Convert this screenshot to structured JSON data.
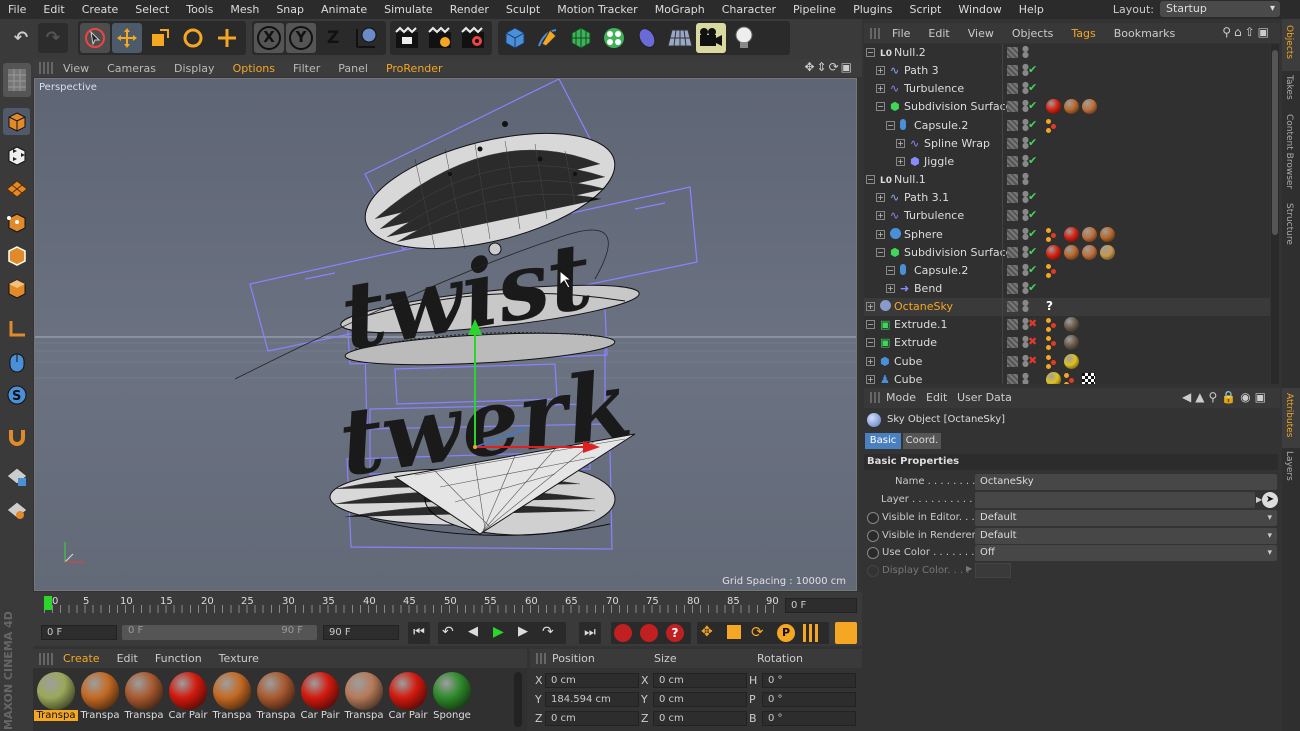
{
  "menubar": {
    "items": [
      "File",
      "Edit",
      "Create",
      "Select",
      "Tools",
      "Mesh",
      "Snap",
      "Animate",
      "Simulate",
      "Render",
      "Sculpt",
      "Motion Tracker",
      "MoGraph",
      "Character",
      "Pipeline",
      "Plugins",
      "Script",
      "Window",
      "Help"
    ],
    "layout_label": "Layout:",
    "layout_value": "Startup"
  },
  "toolbar": {
    "axis_x": "X",
    "axis_y": "Y",
    "axis_z": "Z"
  },
  "viewport_menu": [
    "View",
    "Cameras",
    "Display",
    "Options",
    "Filter",
    "Panel",
    "ProRender"
  ],
  "viewport": {
    "label": "Perspective",
    "grid_spacing": "Grid Spacing : 10000 cm",
    "art_text_1": "twist",
    "art_text_2": "twerk"
  },
  "timeline": {
    "ticks": [
      "0",
      "5",
      "10",
      "15",
      "20",
      "25",
      "30",
      "35",
      "40",
      "45",
      "50",
      "55",
      "60",
      "65",
      "70",
      "75",
      "80",
      "85",
      "90"
    ],
    "current_frame": "0 F",
    "start_frame": "0 F",
    "range_start": "0 F",
    "range_end": "90 F",
    "end_frame": "90 F"
  },
  "material_manager": {
    "menu": [
      "Create",
      "Edit",
      "Function",
      "Texture"
    ],
    "materials": [
      {
        "label": "Transpa",
        "color": "#9aa85a",
        "selected": true
      },
      {
        "label": "Transpa",
        "color": "#c46a24"
      },
      {
        "label": "Transpa",
        "color": "#a85a30"
      },
      {
        "label": "Car Pair",
        "color": "#d21a0e"
      },
      {
        "label": "Transpa",
        "color": "#c46a24"
      },
      {
        "label": "Transpa",
        "color": "#a85a30"
      },
      {
        "label": "Car Pair",
        "color": "#d21a0e"
      },
      {
        "label": "Transpa",
        "color": "#b57a5a"
      },
      {
        "label": "Car Pair",
        "color": "#d21a0e"
      },
      {
        "label": "Sponge",
        "color": "#2e8a2a"
      }
    ]
  },
  "coordinates": {
    "headers": [
      "Position",
      "Size",
      "Rotation"
    ],
    "rows": [
      {
        "pos_axis": "X",
        "pos": "0 cm",
        "size_axis": "X",
        "size": "0 cm",
        "rot_axis": "H",
        "rot": "0 °"
      },
      {
        "pos_axis": "Y",
        "pos": "184.594 cm",
        "size_axis": "Y",
        "size": "0 cm",
        "rot_axis": "P",
        "rot": "0 °"
      },
      {
        "pos_axis": "Z",
        "pos": "0 cm",
        "size_axis": "Z",
        "size": "0 cm",
        "rot_axis": "B",
        "rot": "0 °"
      }
    ]
  },
  "object_manager": {
    "menu": [
      "File",
      "Edit",
      "View",
      "Objects",
      "Tags",
      "Bookmarks"
    ],
    "objects": [
      {
        "name": "Null.2",
        "indent": 0,
        "icon": "null",
        "check": "none",
        "tags": []
      },
      {
        "name": "Path 3",
        "indent": 1,
        "icon": "spline",
        "check": "ok",
        "tags": []
      },
      {
        "name": "Turbulence",
        "indent": 1,
        "icon": "deformer",
        "check": "ok",
        "tags": []
      },
      {
        "name": "Subdivision Surface",
        "indent": 1,
        "icon": "subd",
        "check": "ok",
        "tags": [
          "#d82010",
          "#b8682a",
          "#c0703a"
        ]
      },
      {
        "name": "Capsule.2",
        "indent": 2,
        "icon": "capsule",
        "check": "ok",
        "tags": [
          "dots"
        ]
      },
      {
        "name": "Spline Wrap",
        "indent": 3,
        "icon": "deformer",
        "check": "ok",
        "tags": []
      },
      {
        "name": "Jiggle",
        "indent": 3,
        "icon": "jiggle",
        "check": "ok",
        "tags": []
      },
      {
        "name": "Null.1",
        "indent": 0,
        "icon": "null",
        "check": "none",
        "tags": []
      },
      {
        "name": "Path 3.1",
        "indent": 1,
        "icon": "spline",
        "check": "ok",
        "tags": []
      },
      {
        "name": "Turbulence",
        "indent": 1,
        "icon": "deformer",
        "check": "ok",
        "tags": []
      },
      {
        "name": "Sphere",
        "indent": 1,
        "icon": "sphere",
        "check": "ok",
        "tags": [
          "dots",
          "#d82010",
          "#c0703a",
          "#b8682a"
        ]
      },
      {
        "name": "Subdivision Surface",
        "indent": 1,
        "icon": "subd",
        "check": "ok",
        "tags": [
          "#d82010",
          "#b8682a",
          "#c0703a",
          "#c8984a"
        ]
      },
      {
        "name": "Capsule.2",
        "indent": 2,
        "icon": "capsule",
        "check": "ok",
        "tags": [
          "dots"
        ]
      },
      {
        "name": "Bend",
        "indent": 2,
        "icon": "bend",
        "check": "ok",
        "tags": []
      },
      {
        "name": "OctaneSky",
        "indent": 0,
        "icon": "sky",
        "check": "none",
        "tags": [
          "?"
        ],
        "highlight": true
      },
      {
        "name": "Extrude.1",
        "indent": 0,
        "icon": "extrude",
        "check": "off",
        "tags": [
          "dots",
          "#6a5a4a"
        ]
      },
      {
        "name": "Extrude",
        "indent": 0,
        "icon": "extrude",
        "check": "off",
        "tags": [
          "dots",
          "#6a5a4a"
        ]
      },
      {
        "name": "Cube",
        "indent": 0,
        "icon": "cube",
        "check": "off",
        "tags": [
          "dots",
          "#e0c020"
        ]
      },
      {
        "name": "Cube",
        "indent": 0,
        "icon": "figure",
        "check": "none",
        "tags": [
          "#e0c020",
          "dots",
          "checker"
        ]
      }
    ]
  },
  "attributes": {
    "menu": [
      "Mode",
      "Edit",
      "User Data"
    ],
    "object_title": "Sky Object [OctaneSky]",
    "tabs": [
      "Basic",
      "Coord."
    ],
    "section": "Basic Properties",
    "fields": [
      {
        "label": "Name . . . . . . . . . . .",
        "value": "OctaneSky",
        "type": "text"
      },
      {
        "label": "Layer  . . . . . . . . . . .",
        "value": "",
        "type": "layer"
      },
      {
        "label": "Visible in Editor. . .",
        "value": "Default",
        "type": "dropdown",
        "radio": true
      },
      {
        "label": "Visible in Renderer",
        "value": "Default",
        "type": "dropdown",
        "radio": true
      },
      {
        "label": "Use Color  . . . . . . .",
        "value": "Off",
        "type": "dropdown",
        "radio": true
      },
      {
        "label": "Display Color. . . .",
        "value": "",
        "type": "color",
        "disabled": true
      }
    ]
  },
  "right_tabs": [
    "Objects",
    "Takes",
    "Content Browser",
    "Structure",
    "Attributes",
    "Layers"
  ],
  "brand_text": "MAXON CINEMA 4D"
}
